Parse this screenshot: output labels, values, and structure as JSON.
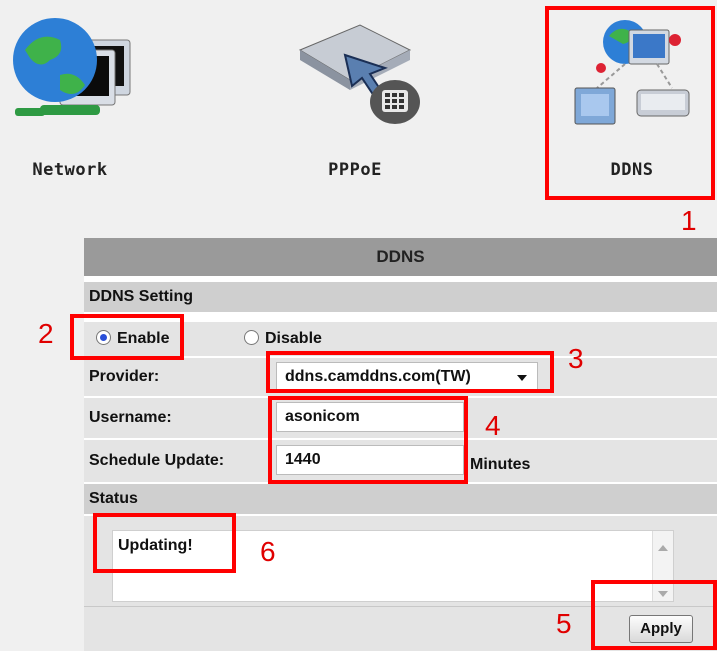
{
  "nav": {
    "items": [
      {
        "label": "Network",
        "icon": "network-globe-computers-icon"
      },
      {
        "label": "PPPoE",
        "icon": "pppoe-modem-phone-icon"
      },
      {
        "label": "DDNS",
        "icon": "ddns-computers-globe-icon"
      }
    ]
  },
  "panel": {
    "title": "DDNS",
    "setting_header": "DDNS Setting",
    "enable_label": "Enable",
    "disable_label": "Disable",
    "selected": "Enable",
    "provider_label": "Provider:",
    "provider_value": "ddns.camddns.com(TW)",
    "username_label": "Username:",
    "username_value": "asonicom",
    "schedule_label": "Schedule Update:",
    "schedule_value": "1440",
    "schedule_unit": "Minutes",
    "status_header": "Status",
    "status_text": "Updating!",
    "apply_label": "Apply"
  },
  "callouts": [
    "1",
    "2",
    "3",
    "4",
    "5",
    "6"
  ],
  "colors": {
    "callout": "#ff0000",
    "title_bar": "#9a9a9a",
    "section_bar": "#cfcfcf",
    "row_bg": "#e4e4e4"
  }
}
